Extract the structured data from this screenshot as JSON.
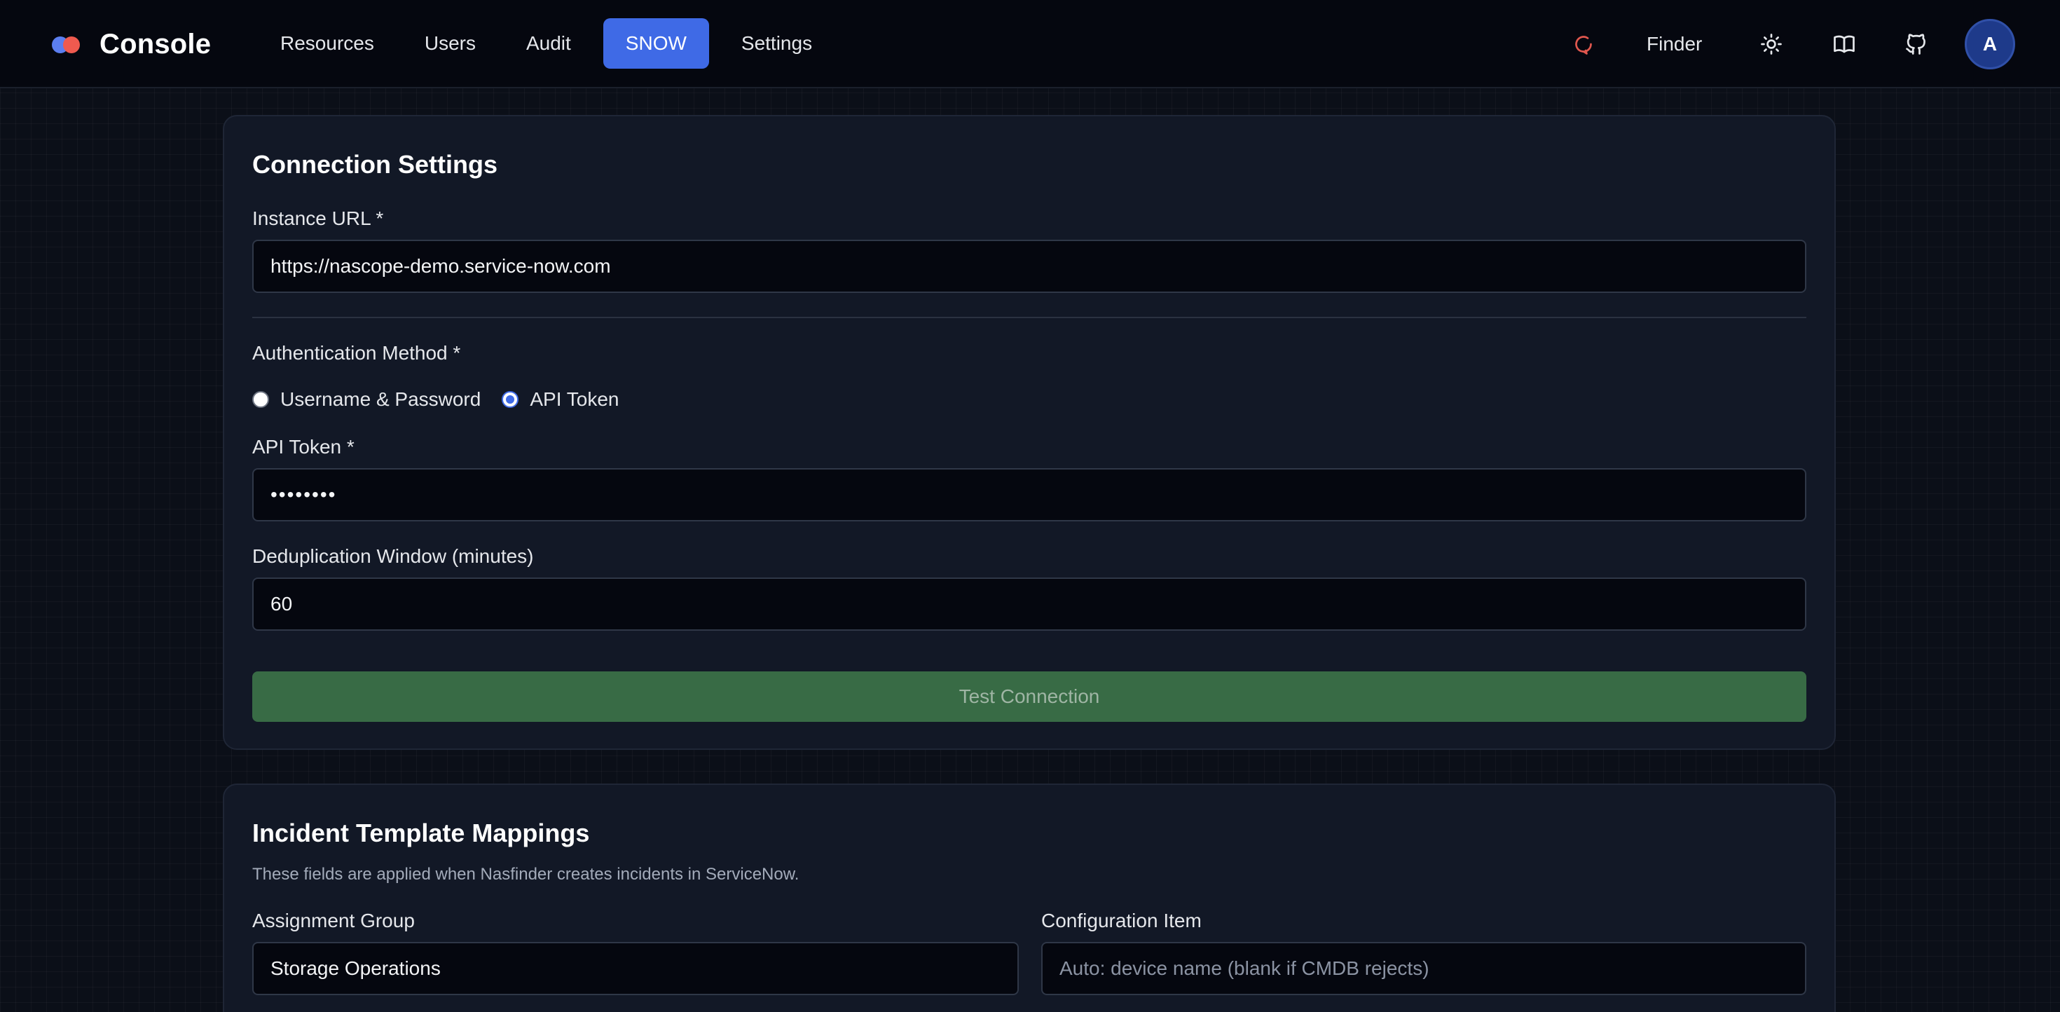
{
  "navbar": {
    "brand": "Console",
    "links": [
      "Resources",
      "Users",
      "Audit",
      "SNOW",
      "Settings"
    ],
    "active_link": "SNOW",
    "finder_label": "Finder",
    "avatar_initial": "A",
    "icons": [
      "refresh-icon",
      "sun-icon",
      "book-icon",
      "github-icon"
    ]
  },
  "connection": {
    "title": "Connection Settings",
    "instance_url_label": "Instance URL *",
    "instance_url_value": "https://nascope-demo.service-now.com",
    "auth_label": "Authentication Method *",
    "auth_options": [
      "Username & Password",
      "API Token"
    ],
    "auth_selected": "API Token",
    "token_label": "API Token *",
    "token_value": "••••••••",
    "dedup_label": "Deduplication Window (minutes)",
    "dedup_value": "60",
    "test_button": "Test Connection"
  },
  "incident": {
    "title": "Incident Template Mappings",
    "description": "These fields are applied when Nasfinder creates incidents in ServiceNow.",
    "assignment_group_label": "Assignment Group",
    "assignment_group_value": "Storage Operations",
    "config_item_label": "Configuration Item",
    "config_item_placeholder": "Auto: device name (blank if CMDB rejects)"
  },
  "colors": {
    "accent": "#3f6ae6",
    "success_button": "#386b45",
    "refresh_icon": "#e0574e",
    "brand_dot_blue": "#5b7ef0",
    "brand_dot_red": "#ef5a4f"
  }
}
